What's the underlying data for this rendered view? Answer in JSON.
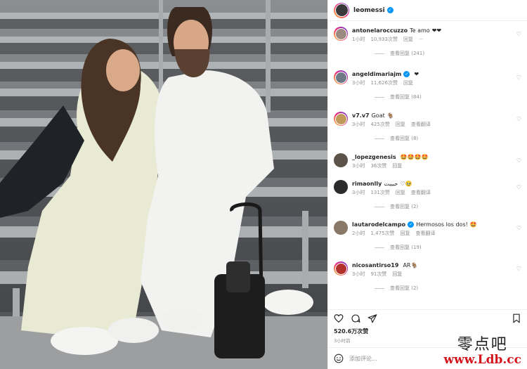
{
  "post": {
    "username": "leomessi",
    "likes": "520.6万次赞",
    "time": "3小时前",
    "add_comment_placeholder": "添加评论..."
  },
  "comments": [
    {
      "user": "antonelaroccuzzo",
      "text": "Te amo",
      "emoji": "❤❤",
      "time": "1小时",
      "likes": "10,933次赞",
      "reply": "回复",
      "translate": "",
      "more": "···",
      "view_replies": "查看回复 (241)",
      "avatar_color": "#9a8a80",
      "ring": true,
      "verified": false
    },
    {
      "user": "angeldimariajm",
      "text": "",
      "emoji": "❤",
      "time": "3小时",
      "likes": "11,626次赞",
      "reply": "回复",
      "translate": "",
      "more": "",
      "view_replies": "查看回复 (84)",
      "avatar_color": "#6d7a86",
      "ring": true,
      "verified": true
    },
    {
      "user": "v7.v7",
      "text": "Goat",
      "emoji": "🐐",
      "time": "3小时",
      "likes": "425次赞",
      "reply": "回复",
      "translate": "查看翻译",
      "more": "",
      "view_replies": "查看回复 (8)",
      "avatar_color": "#c19a5b",
      "ring": true,
      "verified": false
    },
    {
      "user": "_lopezgenesis",
      "text": "",
      "emoji": "🤩🤩🤩🤩",
      "time": "3小时",
      "likes": "36次赞",
      "reply": "回复",
      "translate": "",
      "more": "",
      "view_replies": "",
      "avatar_color": "#5b5349",
      "ring": false,
      "verified": false
    },
    {
      "user": "rimaonlly",
      "text": "حبيبت",
      "emoji": "♡🥹",
      "time": "3小时",
      "likes": "131次赞",
      "reply": "回复",
      "translate": "查看翻译",
      "more": "",
      "view_replies": "查看回复 (2)",
      "avatar_color": "#2b2b2b",
      "ring": false,
      "verified": false
    },
    {
      "user": "lautarodelcampo",
      "text": "Hermosos los dos!",
      "emoji": "🤩",
      "time": "2小时",
      "likes": "1,475次赞",
      "reply": "回复",
      "translate": "查看翻译",
      "more": "",
      "view_replies": "查看回复 (19)",
      "avatar_color": "#8a7866",
      "ring": false,
      "verified": true
    },
    {
      "user": "nicosantirso19",
      "text": "",
      "emoji": "AR🐐",
      "time": "3小时",
      "likes": "91次赞",
      "reply": "回复",
      "translate": "",
      "more": "",
      "view_replies": "查看回复 (2)",
      "avatar_color": "#b3312c",
      "ring": true,
      "verified": false
    }
  ],
  "icons": {
    "like": "heart-outline-icon",
    "comment": "comment-bubble-icon",
    "share": "paper-plane-icon",
    "save": "bookmark-icon",
    "emoji": "smiley-icon"
  },
  "watermark": {
    "top": "零点吧",
    "bottom": "www.Ldb.cc"
  }
}
